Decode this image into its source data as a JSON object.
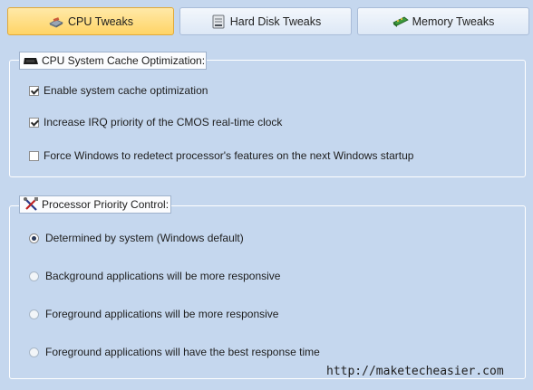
{
  "tabs": [
    {
      "label": "CPU Tweaks",
      "icon": "cpu-icon",
      "active": true
    },
    {
      "label": "Hard Disk Tweaks",
      "icon": "hard-disk-icon",
      "active": false
    },
    {
      "label": "Memory Tweaks",
      "icon": "memory-icon",
      "active": false
    }
  ],
  "cache_group": {
    "title": "CPU System Cache Optimization:",
    "icon": "chip-icon",
    "options": [
      {
        "label": "Enable system cache optimization",
        "checked": true
      },
      {
        "label": "Increase IRQ priority of the CMOS real-time clock",
        "checked": true
      },
      {
        "label": "Force Windows to redetect processor's features on the next Windows startup",
        "checked": false
      }
    ]
  },
  "priority_group": {
    "title": "Processor Priority Control:",
    "icon": "tools-icon",
    "options": [
      {
        "label": "Determined by system (Windows default)",
        "selected": true
      },
      {
        "label": "Background applications will be more responsive",
        "selected": false
      },
      {
        "label": "Foreground applications will be more responsive",
        "selected": false
      },
      {
        "label": "Foreground applications will have the best response time",
        "selected": false
      }
    ]
  },
  "watermark": "http://maketecheasier.com",
  "colors": {
    "background": "#c5d7ee",
    "active_tab": "#ffd466",
    "group_border": "#ffffff"
  }
}
